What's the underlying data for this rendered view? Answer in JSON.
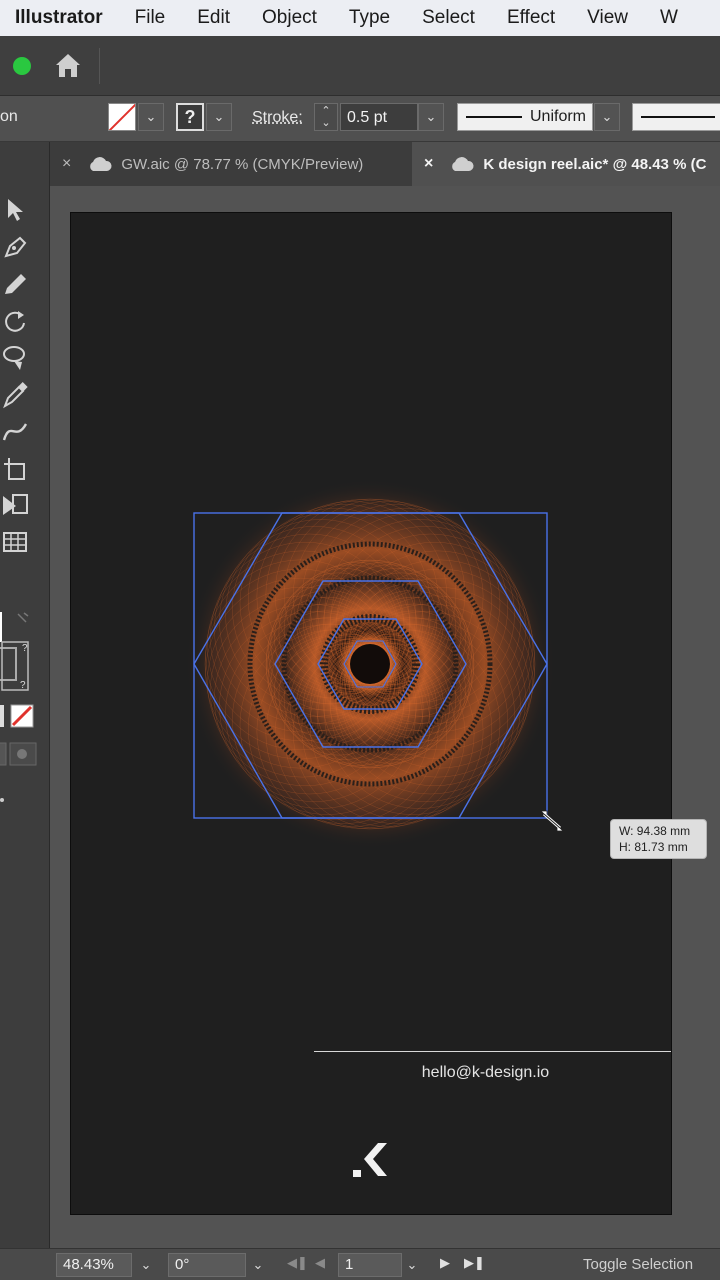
{
  "menubar": {
    "app_name": "Illustrator",
    "items": [
      "File",
      "Edit",
      "Object",
      "Type",
      "Select",
      "Effect",
      "View",
      "W"
    ]
  },
  "appbar": {
    "icons": [
      "window-zoom-button",
      "home-icon"
    ]
  },
  "controlbar": {
    "selection_label": "on",
    "stroke_label": "Stroke:",
    "stroke_weight": "0.5 pt",
    "profile_label": "Uniform",
    "stroke_color_unknown": "?"
  },
  "tabs": [
    {
      "label": "GW.aic @ 78.77 % (CMYK/Preview)",
      "active": false
    },
    {
      "label": "K design reel.aic* @ 48.43 % (C",
      "active": true
    }
  ],
  "canvas": {
    "size_tooltip": {
      "w": "W: 94.38 mm",
      "h": "H: 81.73 mm"
    },
    "email": "hello@k-design.io",
    "logo": "K",
    "colors": {
      "artboard": "#1f1f1f",
      "pattern": "#d8682c",
      "selection": "#4a72e8"
    }
  },
  "statusbar": {
    "zoom": "48.43%",
    "rotation": "0°",
    "artboard_number": "1",
    "toggle_label": "Toggle Selection"
  }
}
